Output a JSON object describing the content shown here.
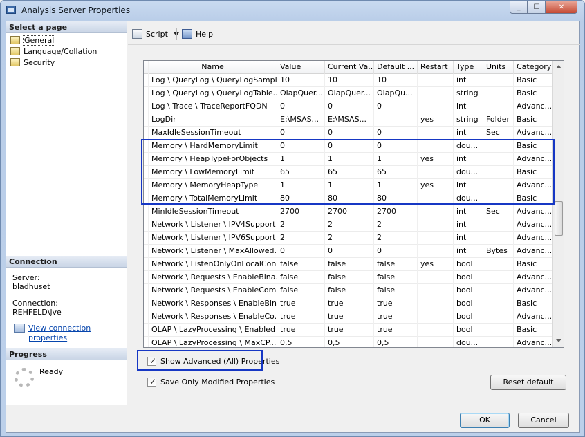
{
  "window": {
    "title": "Analysis Server Properties"
  },
  "left": {
    "select_page_title": "Select a page",
    "pages": [
      {
        "label": "General",
        "selected": true
      },
      {
        "label": "Language/Collation",
        "selected": false
      },
      {
        "label": "Security",
        "selected": false
      }
    ],
    "connection_title": "Connection",
    "server_label": "Server:",
    "server_value": "bladhuset",
    "connection_label": "Connection:",
    "connection_value": "REHFELD\\jve",
    "view_link": "View connection properties",
    "progress_title": "Progress",
    "progress_status": "Ready"
  },
  "toolbar": {
    "script_label": "Script",
    "help_label": "Help"
  },
  "grid": {
    "columns": [
      "Name",
      "Value",
      "Current Va...",
      "Default ...",
      "Restart",
      "Type",
      "Units",
      "Category"
    ],
    "rows": [
      [
        "Log \\ QueryLog \\ QueryLogSampli...",
        "10",
        "10",
        "10",
        "",
        "int",
        "",
        "Basic"
      ],
      [
        "Log \\ QueryLog \\ QueryLogTable...",
        "OlapQuer...",
        "OlapQuer...",
        "OlapQu...",
        "",
        "string",
        "",
        "Basic"
      ],
      [
        "Log \\ Trace \\ TraceReportFQDN",
        "0",
        "0",
        "0",
        "",
        "int",
        "",
        "Advanc..."
      ],
      [
        "LogDir",
        "E:\\MSAS...",
        "E:\\MSAS...",
        "",
        "yes",
        "string",
        "Folder",
        "Basic"
      ],
      [
        "MaxIdleSessionTimeout",
        "0",
        "0",
        "0",
        "",
        "int",
        "Sec",
        "Advanc..."
      ],
      [
        "Memory \\ HardMemoryLimit",
        "0",
        "0",
        "0",
        "",
        "dou...",
        "",
        "Basic"
      ],
      [
        "Memory \\ HeapTypeForObjects",
        "1",
        "1",
        "1",
        "yes",
        "int",
        "",
        "Advanc..."
      ],
      [
        "Memory \\ LowMemoryLimit",
        "65",
        "65",
        "65",
        "",
        "dou...",
        "",
        "Basic"
      ],
      [
        "Memory \\ MemoryHeapType",
        "1",
        "1",
        "1",
        "yes",
        "int",
        "",
        "Advanc..."
      ],
      [
        "Memory \\ TotalMemoryLimit",
        "80",
        "80",
        "80",
        "",
        "dou...",
        "",
        "Basic"
      ],
      [
        "MinIdleSessionTimeout",
        "2700",
        "2700",
        "2700",
        "",
        "int",
        "Sec",
        "Advanc..."
      ],
      [
        "Network \\ Listener \\ IPV4Support",
        "2",
        "2",
        "2",
        "",
        "int",
        "",
        "Advanc..."
      ],
      [
        "Network \\ Listener \\ IPV6Support",
        "2",
        "2",
        "2",
        "",
        "int",
        "",
        "Advanc..."
      ],
      [
        "Network \\ Listener \\ MaxAllowed...",
        "0",
        "0",
        "0",
        "",
        "int",
        "Bytes",
        "Advanc..."
      ],
      [
        "Network \\ ListenOnlyOnLocalCon...",
        "false",
        "false",
        "false",
        "yes",
        "bool",
        "",
        "Basic"
      ],
      [
        "Network \\ Requests \\ EnableBina...",
        "false",
        "false",
        "false",
        "",
        "bool",
        "",
        "Advanc..."
      ],
      [
        "Network \\ Requests \\ EnableCom...",
        "false",
        "false",
        "false",
        "",
        "bool",
        "",
        "Advanc..."
      ],
      [
        "Network \\ Responses \\ EnableBin...",
        "true",
        "true",
        "true",
        "",
        "bool",
        "",
        "Basic"
      ],
      [
        "Network \\ Responses \\ EnableCo...",
        "true",
        "true",
        "true",
        "",
        "bool",
        "",
        "Advanc..."
      ],
      [
        "OLAP \\ LazyProcessing \\ Enabled",
        "true",
        "true",
        "true",
        "",
        "bool",
        "",
        "Basic"
      ],
      [
        "OLAP \\ LazyProcessing \\ MaxCP...",
        "0,5",
        "0,5",
        "0,5",
        "",
        "dou...",
        "",
        "Advanc..."
      ]
    ]
  },
  "options": {
    "show_advanced": "Show Advanced (All) Properties",
    "save_modified": "Save Only Modified Properties",
    "reset_default": "Reset default"
  },
  "footer": {
    "ok": "OK",
    "cancel": "Cancel"
  }
}
